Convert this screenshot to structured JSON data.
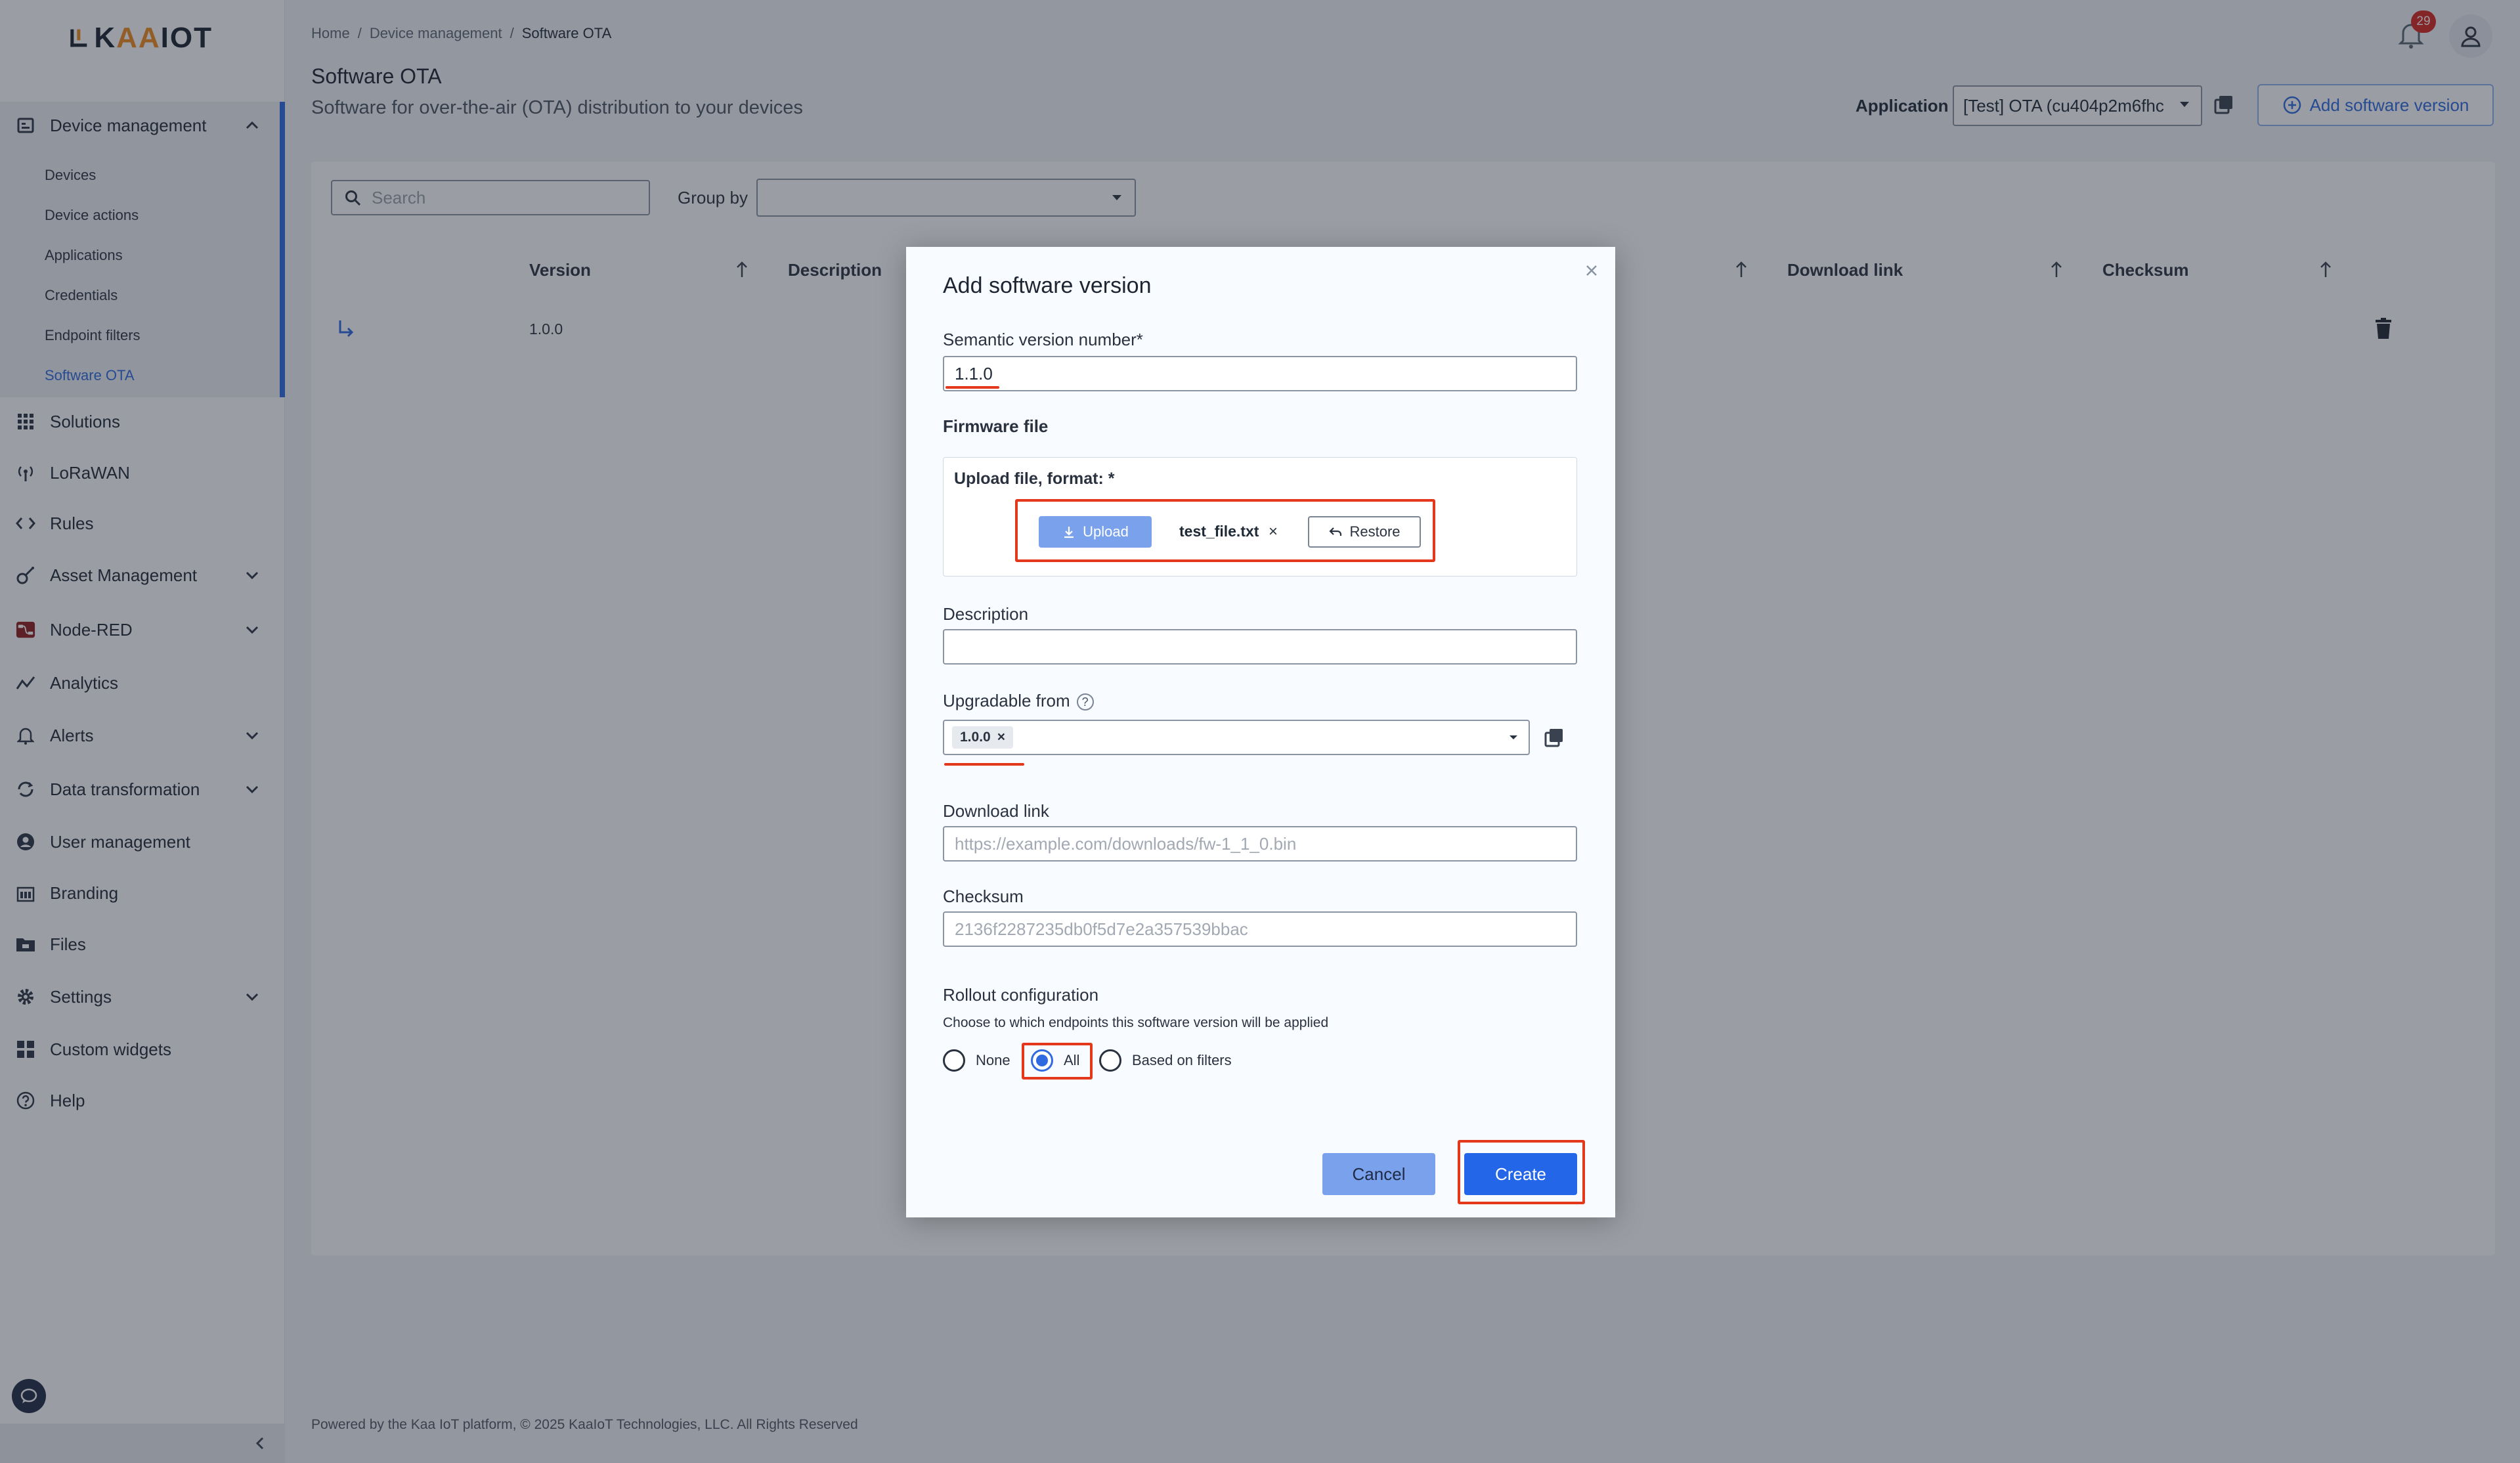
{
  "brand": {
    "logo_text": "KAAIOT",
    "accent": "#2f6ae0",
    "highlight": "#e4381d"
  },
  "sidebar": {
    "device_management": {
      "label": "Device management",
      "items": [
        "Devices",
        "Device actions",
        "Applications",
        "Credentials",
        "Endpoint filters",
        "Software OTA"
      ],
      "active": "Software OTA"
    },
    "items": [
      {
        "label": "Solutions",
        "icon": "grid-icon"
      },
      {
        "label": "LoRaWAN",
        "icon": "antenna-icon"
      },
      {
        "label": "Rules",
        "icon": "code-icon"
      },
      {
        "label": "Asset Management",
        "icon": "asset-icon"
      },
      {
        "label": "Node-RED",
        "icon": "node-red-icon"
      },
      {
        "label": "Analytics",
        "icon": "analytics-icon"
      },
      {
        "label": "Alerts",
        "icon": "bell-icon"
      },
      {
        "label": "Data transformation",
        "icon": "transform-icon"
      },
      {
        "label": "User management",
        "icon": "user-icon"
      },
      {
        "label": "Branding",
        "icon": "branding-icon"
      },
      {
        "label": "Files",
        "icon": "folder-icon"
      },
      {
        "label": "Settings",
        "icon": "gear-icon"
      },
      {
        "label": "Custom widgets",
        "icon": "widgets-icon"
      },
      {
        "label": "Help",
        "icon": "help-icon"
      }
    ]
  },
  "header": {
    "breadcrumb": [
      "Home",
      "Device management",
      "Software OTA"
    ],
    "breadcrumb_sep": "/",
    "title": "Software OTA",
    "subtitle": "Software for over-the-air (OTA) distribution to your devices",
    "notification_count": "29",
    "application_label": "Application",
    "application_value": "[Test] OTA (cu404p2m6fhc",
    "add_button": "Add software version"
  },
  "toolbar": {
    "search_placeholder": "Search",
    "group_by_label": "Group by",
    "group_by_value": ""
  },
  "table": {
    "columns": [
      "Version",
      "Description",
      "Download link",
      "Checksum"
    ],
    "rows": [
      {
        "version": "1.0.0"
      }
    ]
  },
  "dialog": {
    "title": "Add software version",
    "semantic_label": "Semantic version number*",
    "semantic_value": "1.1.0",
    "firmware_label": "Firmware file",
    "upload_label": "Upload file, format: *",
    "upload_button": "Upload",
    "file_name": "test_file.txt",
    "remove_symbol": "×",
    "restore_button": "Restore",
    "description_label": "Description",
    "description_value": "",
    "upgradable_label": "Upgradable from",
    "help_symbol": "?",
    "upgradable_chip": "1.0.0",
    "download_label": "Download link",
    "download_placeholder": "https://example.com/downloads/fw-1_1_0.bin",
    "checksum_label": "Checksum",
    "checksum_placeholder": "2136f2287235db0f5d7e2a357539bbac",
    "rollout_label": "Rollout configuration",
    "rollout_hint": "Choose to which endpoints this software version will be applied",
    "rollout_options": [
      "None",
      "All",
      "Based on filters"
    ],
    "rollout_selected": "All",
    "cancel_button": "Cancel",
    "create_button": "Create"
  },
  "footer": {
    "text": "Powered by the Kaa IoT platform, © 2025 KaaIoT Technologies, LLC. All Rights Reserved"
  }
}
